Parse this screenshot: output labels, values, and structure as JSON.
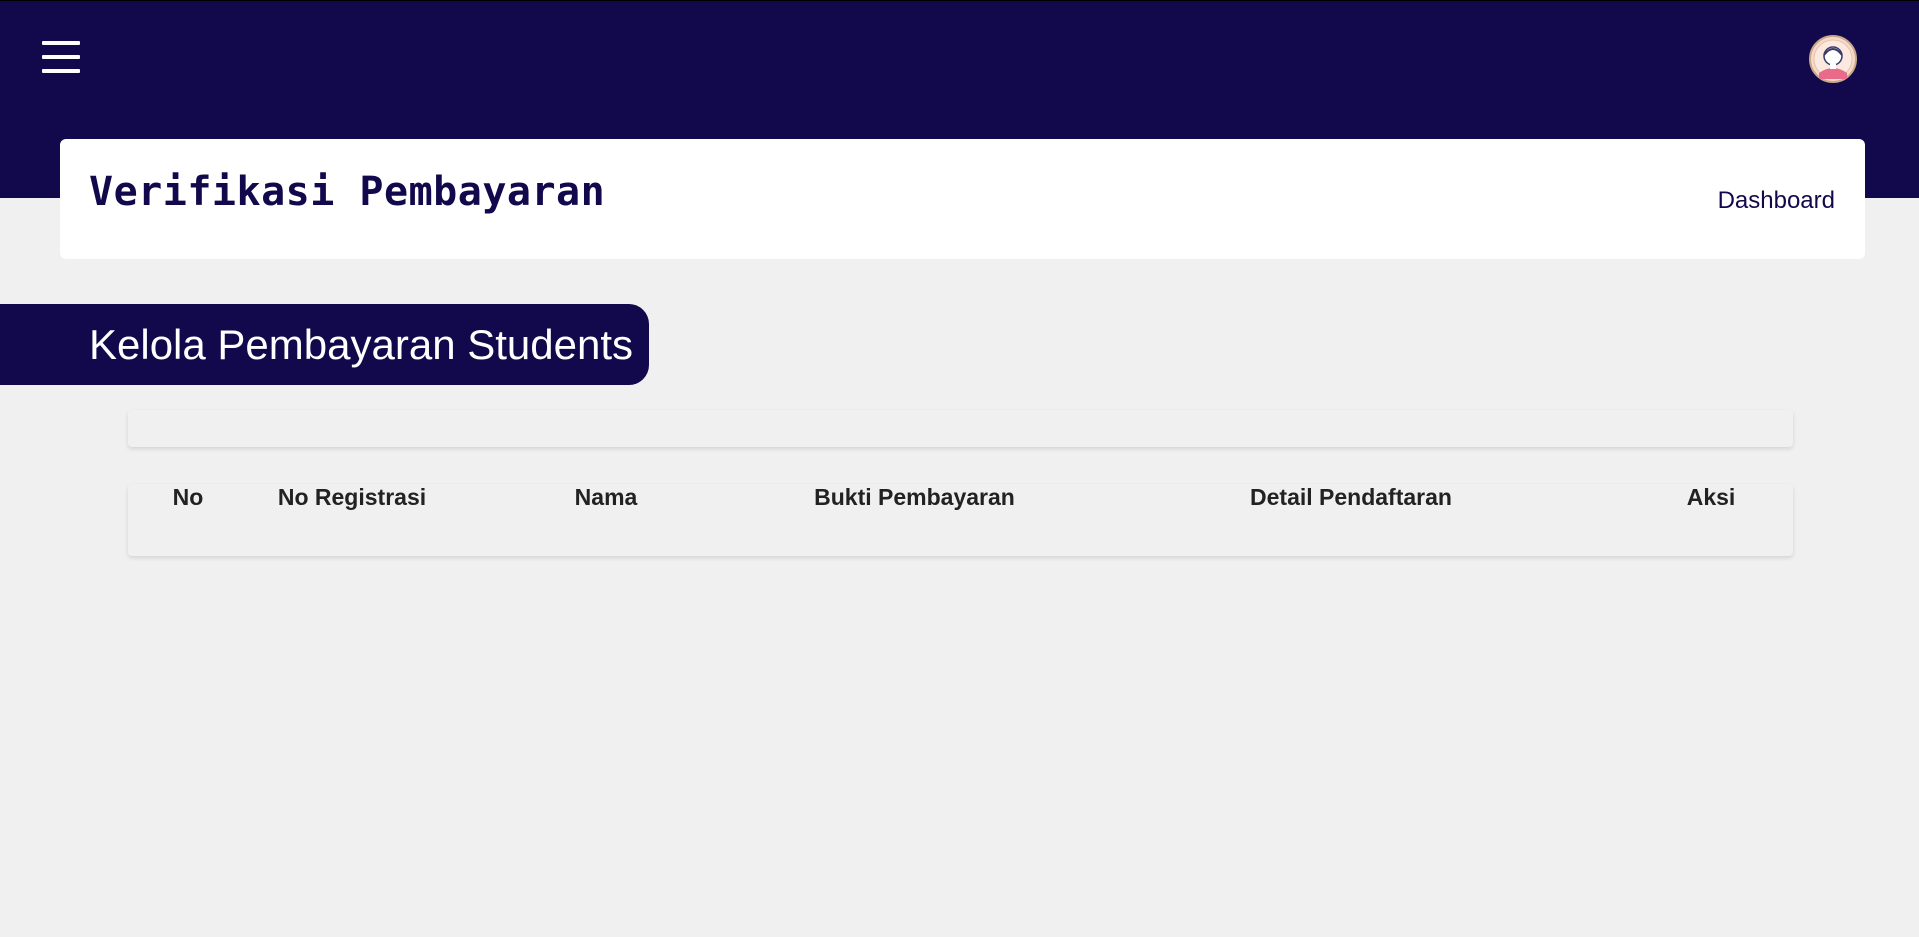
{
  "app": {
    "accent_color": "#12084c",
    "menu_icon": "hamburger-menu-icon",
    "avatar_icon": "user-avatar-icon"
  },
  "header": {
    "title": "Verifikasi Pembayaran",
    "breadcrumb": "Dashboard"
  },
  "section": {
    "title": "Kelola Pembayaran Students"
  },
  "table": {
    "columns": [
      "No",
      "No Registrasi",
      "Nama",
      "Bukti Pembayaran",
      "Detail Pendaftaran",
      "Aksi"
    ],
    "rows": []
  }
}
